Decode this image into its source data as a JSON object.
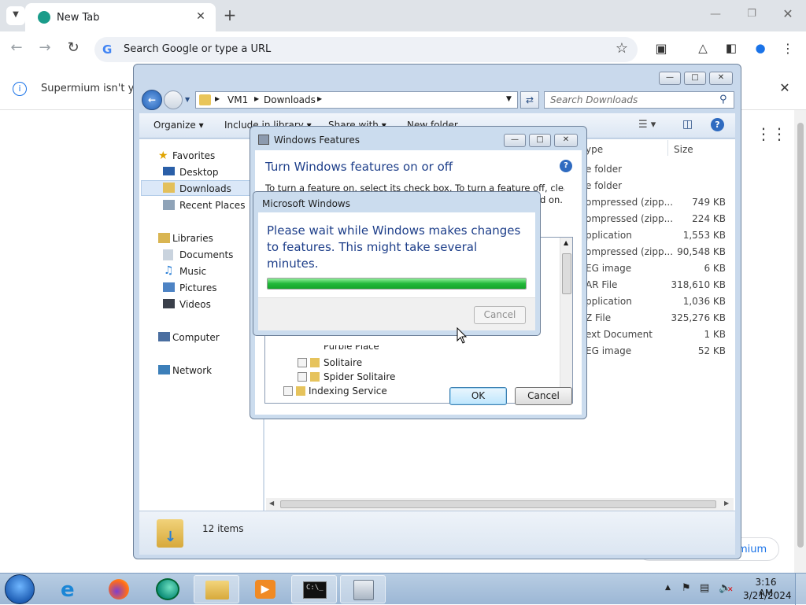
{
  "browser": {
    "tab_title": "New Tab",
    "omnibox_placeholder": "Search Google or type a URL",
    "infobar_text": "Supermium isn't you",
    "bottom_chip_text": "mium"
  },
  "explorer": {
    "address_path": [
      "VM1",
      "Downloads"
    ],
    "search_placeholder": "Search Downloads",
    "commands": {
      "organize": "Organize",
      "include": "Include in library",
      "share": "Share with",
      "new_folder": "New folder"
    },
    "columns": {
      "type": "ype",
      "size": "Size"
    },
    "nav": {
      "favorites": "Favorites",
      "desktop": "Desktop",
      "downloads": "Downloads",
      "recent": "Recent Places",
      "libraries": "Libraries",
      "documents": "Documents",
      "music": "Music",
      "pictures": "Pictures",
      "videos": "Videos",
      "computer": "Computer",
      "network": "Network"
    },
    "files": [
      {
        "type": "e folder",
        "size": ""
      },
      {
        "type": "e folder",
        "size": ""
      },
      {
        "type": "ompressed (zipp...",
        "size": "749 KB"
      },
      {
        "type": "ompressed (zipp...",
        "size": "224 KB"
      },
      {
        "type": "pplication",
        "size": "1,553 KB"
      },
      {
        "type": "ompressed (zipp...",
        "size": "90,548 KB"
      },
      {
        "type": "EG image",
        "size": "6 KB"
      },
      {
        "type": "AR File",
        "size": "318,610 KB"
      },
      {
        "type": "pplication",
        "size": "1,036 KB"
      },
      {
        "type": "Z File",
        "size": "325,276 KB"
      },
      {
        "type": "ext Document",
        "size": "1 KB"
      },
      {
        "type": "EG image",
        "size": "52 KB"
      }
    ],
    "item_count": "12 items"
  },
  "features": {
    "window_title": "Windows Features",
    "heading": "Turn Windows features on or off",
    "desc_line1": "To turn a feature on, select its check box. To turn a feature off, clear its",
    "desc_line2": "d on.",
    "tree": {
      "partial": "Purble Place",
      "solitaire": "Solitaire",
      "spider": "Spider Solitaire",
      "indexing": "Indexing Service"
    },
    "ok": "OK",
    "cancel": "Cancel"
  },
  "progress_dialog": {
    "title": "Microsoft Windows",
    "message": "Please wait while Windows makes changes to features. This might take several minutes.",
    "progress_fraction": 1.0,
    "cancel": "Cancel"
  },
  "taskbar": {
    "time": "3:16 AM",
    "date": "3/21/2024"
  },
  "colors": {
    "accent": "#1e5aa8",
    "progress": "#22b83a",
    "taskbar": "#a9c2de"
  }
}
